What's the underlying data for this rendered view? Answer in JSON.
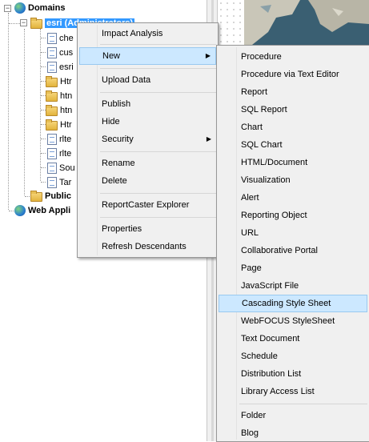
{
  "tree": {
    "root_label": "Domains",
    "selected_label": "esri (Administrators)",
    "children": [
      "che",
      "cus",
      "esri",
      "Htr",
      "htn",
      "htn",
      "Htr",
      "rlte",
      "rlte",
      "Sou",
      "Tar"
    ],
    "public_label": "Public",
    "web_label": "Web Appli"
  },
  "context_menu": {
    "items": [
      "Impact Analysis",
      "New",
      "Upload Data",
      "Publish",
      "Hide",
      "Security",
      "Rename",
      "Delete",
      "ReportCaster Explorer",
      "Properties",
      "Refresh Descendants"
    ],
    "highlighted": "New"
  },
  "submenu": {
    "items": [
      "Procedure",
      "Procedure via Text Editor",
      "Report",
      "SQL Report",
      "Chart",
      "SQL Chart",
      "HTML/Document",
      "Visualization",
      "Alert",
      "Reporting Object",
      "URL",
      "Collaborative Portal",
      "Page",
      "JavaScript File",
      "Cascading Style Sheet",
      "WebFOCUS StyleSheet",
      "Text Document",
      "Schedule",
      "Distribution List",
      "Library Access List",
      "Folder",
      "Blog"
    ],
    "highlighted": "Cascading Style Sheet"
  },
  "icons": {
    "expand_collapse": "minus-box-icon",
    "domain": "globe-icon",
    "folder": "folder-icon",
    "document": "document-icon",
    "submenu_arrow": "chevron-right-icon"
  },
  "colors": {
    "selection": "#3399ff",
    "menu_highlight": "#cce8ff",
    "menu_background": "#f0f0f0"
  }
}
